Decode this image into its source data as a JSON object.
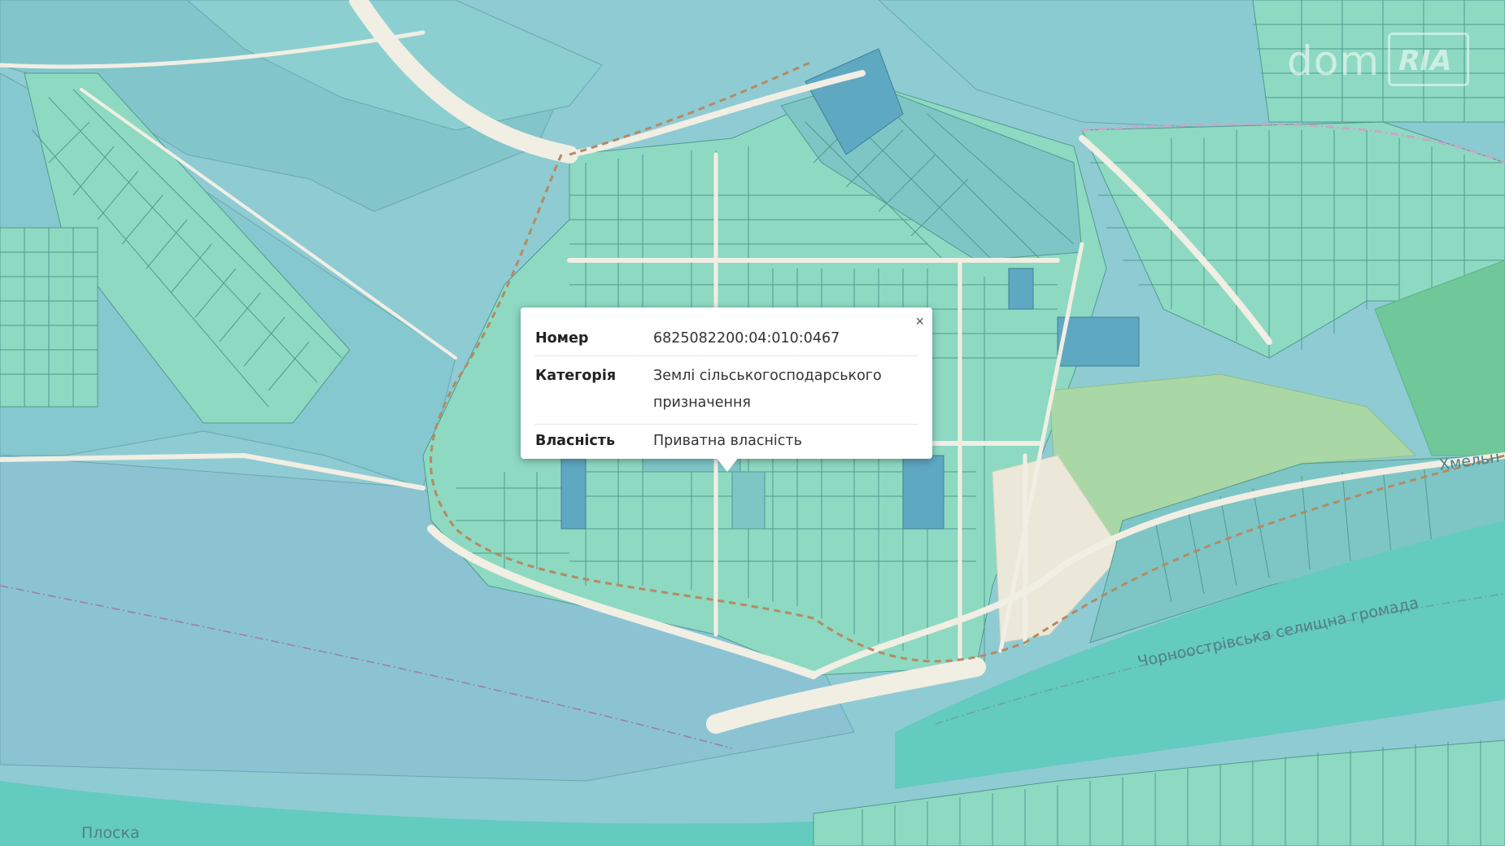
{
  "map": {
    "labels": {
      "community": "Чорноострівська селищна громада",
      "river": "Плоска",
      "road": "Хмельн"
    },
    "colors": {
      "water": "#8fcbd3",
      "parcel_light": "#8ed9c2",
      "parcel_mid": "#7ec5c6",
      "parcel_dark": "#5fa8c2",
      "road": "#f1eee4",
      "forest": "#a9d7a5",
      "river": "#64cbbf",
      "boundary": "#b58a62"
    }
  },
  "popup": {
    "close_label": "×",
    "rows": [
      {
        "key": "Номер",
        "value": "6825082200:04:010:0467"
      },
      {
        "key": "Категорія",
        "value": "Землі сільськогосподарського призначення"
      },
      {
        "key": "Власність",
        "value": "Приватна власність"
      }
    ]
  },
  "watermark": {
    "part1": "dom",
    "part2": "RIA"
  }
}
